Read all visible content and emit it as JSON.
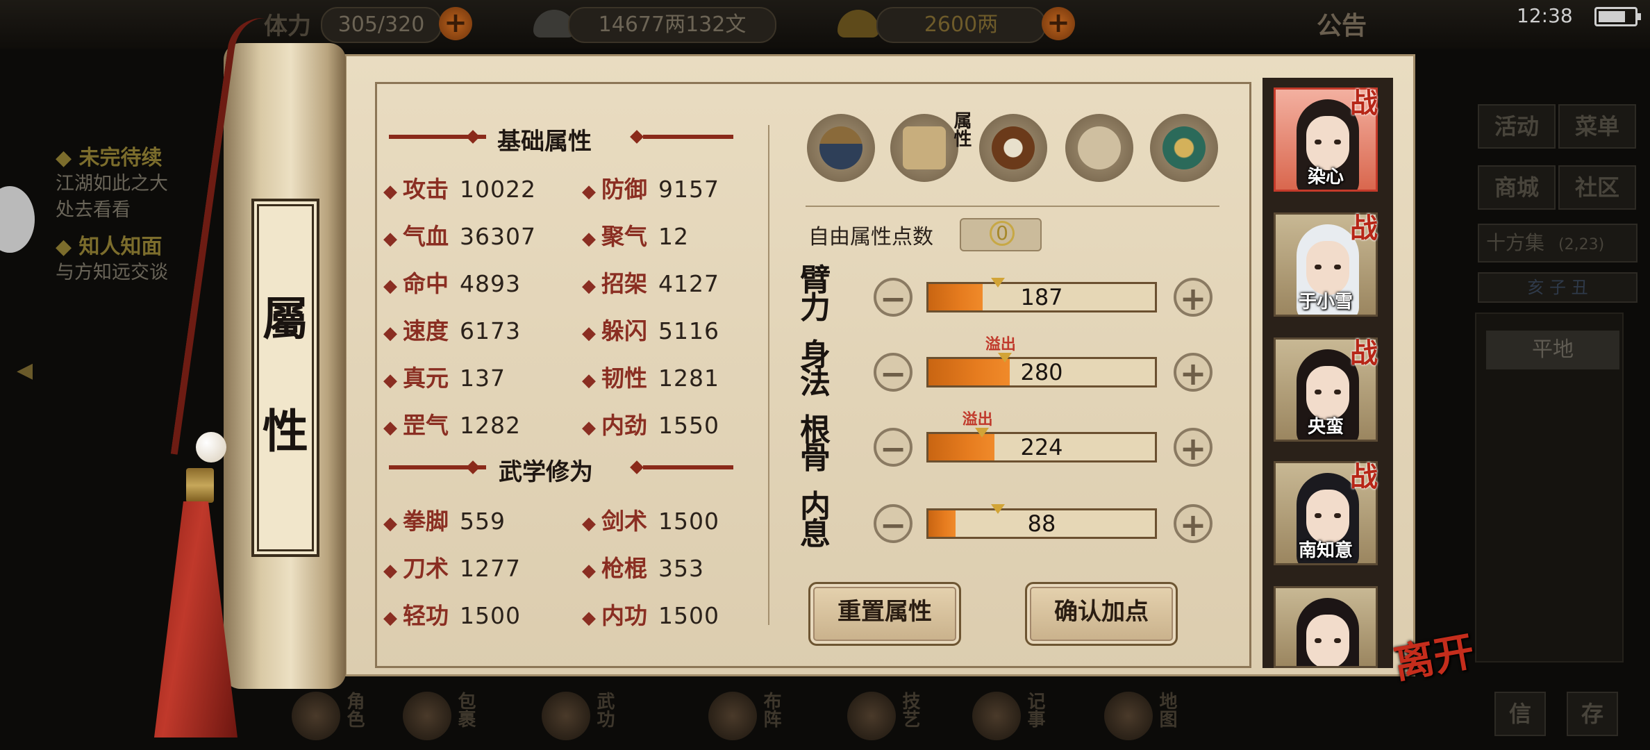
{
  "hud": {
    "stamina_label": "体力",
    "stamina": "305/320",
    "money": "14677两132文",
    "gold": "2600两",
    "notice": "公告",
    "clock": "12:38"
  },
  "quests": [
    {
      "title": "未完待续",
      "desc1": "江湖如此之大",
      "desc2": "处去看看"
    },
    {
      "title": "知人知面",
      "desc1": "与方知远交谈",
      "desc2": ""
    }
  ],
  "scroll_title": {
    "char1": "屬",
    "char2": "性"
  },
  "basic_section_title": "基础属性",
  "basic_stats": [
    {
      "name": "攻击",
      "value": "10022"
    },
    {
      "name": "防御",
      "value": "9157"
    },
    {
      "name": "气血",
      "value": "36307"
    },
    {
      "name": "聚气",
      "value": "12"
    },
    {
      "name": "命中",
      "value": "4893"
    },
    {
      "name": "招架",
      "value": "4127"
    },
    {
      "name": "速度",
      "value": "6173"
    },
    {
      "name": "躲闪",
      "value": "5116"
    },
    {
      "name": "真元",
      "value": "137"
    },
    {
      "name": "韧性",
      "value": "1281"
    },
    {
      "name": "罡气",
      "value": "1282"
    },
    {
      "name": "内劲",
      "value": "1550"
    }
  ],
  "martial_section_title": "武学修为",
  "martial_stats": [
    {
      "name": "拳脚",
      "value": "559"
    },
    {
      "name": "剑术",
      "value": "1500"
    },
    {
      "name": "刀术",
      "value": "1277"
    },
    {
      "name": "枪棍",
      "value": "353"
    },
    {
      "name": "轻功",
      "value": "1500"
    },
    {
      "name": "内功",
      "value": "1500"
    }
  ],
  "tabs": {
    "attributes_label": "属性"
  },
  "free_points": {
    "label": "自由属性点数",
    "value": "0"
  },
  "attributes": [
    {
      "name": "臂力",
      "value": "187",
      "fill": 0.24,
      "marker": 0.31,
      "overflow": ""
    },
    {
      "name": "身法",
      "value": "280",
      "fill": 0.36,
      "marker": 0.34,
      "overflow": "溢出"
    },
    {
      "name": "根骨",
      "value": "224",
      "fill": 0.29,
      "marker": 0.24,
      "overflow": "溢出"
    },
    {
      "name": "内息",
      "value": "88",
      "fill": 0.12,
      "marker": 0.31,
      "overflow": ""
    }
  ],
  "buttons": {
    "reset": "重置属性",
    "confirm": "确认加点"
  },
  "characters": [
    {
      "name": "染心",
      "tag": "战"
    },
    {
      "name": "于小雪",
      "tag": "战"
    },
    {
      "name": "央蛮",
      "tag": "战"
    },
    {
      "name": "南知意",
      "tag": "战"
    },
    {
      "name": "",
      "tag": ""
    }
  ],
  "leave": "离开",
  "side_menu": {
    "activity": "活动",
    "menu": "菜单",
    "shop": "商城",
    "community": "社区",
    "location": "十方集",
    "coords": "(2,23)",
    "time": "亥 子 丑",
    "place": "平地",
    "bottom_left": "信",
    "bottom_right": "存"
  },
  "dock": [
    "角色",
    "包裹",
    "武功",
    "布阵",
    "技艺",
    "记事",
    "地图"
  ],
  "colors": {
    "accent_red": "#8a2e22",
    "bar_orange": "#e67c1f",
    "overflow_red": "#c0392b"
  }
}
